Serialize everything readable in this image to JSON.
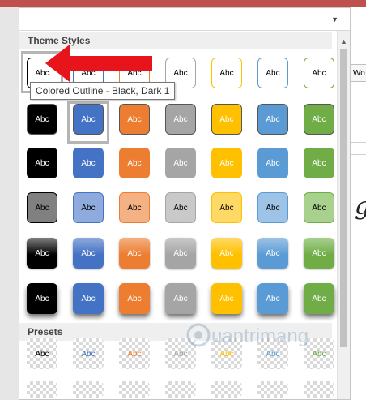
{
  "tooltip_text": "Colored Outline - Black, Dark 1",
  "sections": {
    "theme_styles": "Theme Styles",
    "presets": "Presets"
  },
  "cell_label": "Abc",
  "right_tab_text": "Wo",
  "colors": {
    "black": "#000000",
    "blue": "#4472c4",
    "orange": "#ed7d31",
    "gray": "#a5a5a5",
    "gold": "#ffc000",
    "lightblue": "#5b9bd5",
    "green": "#70ad47",
    "arrow": "#e8141b"
  },
  "watermark_text": "uantrimang"
}
